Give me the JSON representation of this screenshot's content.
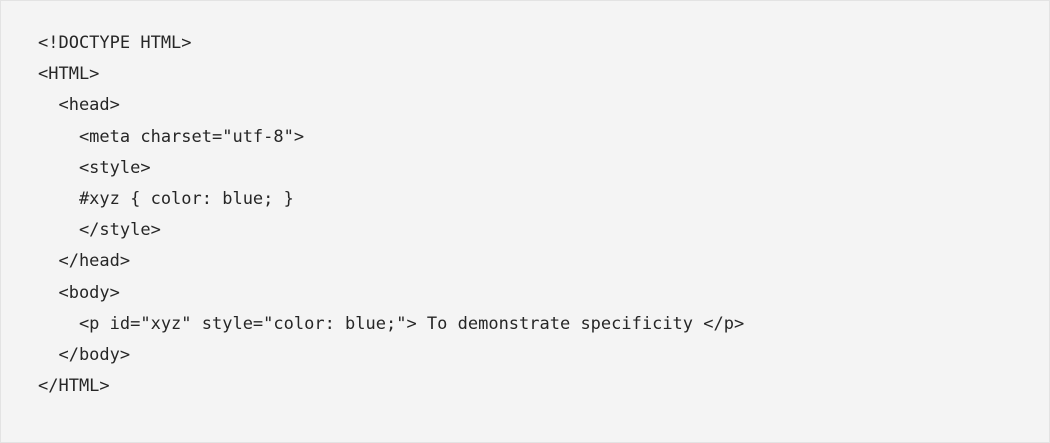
{
  "code": {
    "lines": [
      "<!DOCTYPE HTML>",
      "<HTML>",
      "  <head>",
      "    <meta charset=\"utf-8\">",
      "    <style>",
      "    #xyz { color: blue; }",
      "    </style>",
      "  </head>",
      "  <body>",
      "    <p id=\"xyz\" style=\"color: blue;\"> To demonstrate specificity </p>",
      "  </body>",
      "</HTML>"
    ]
  }
}
